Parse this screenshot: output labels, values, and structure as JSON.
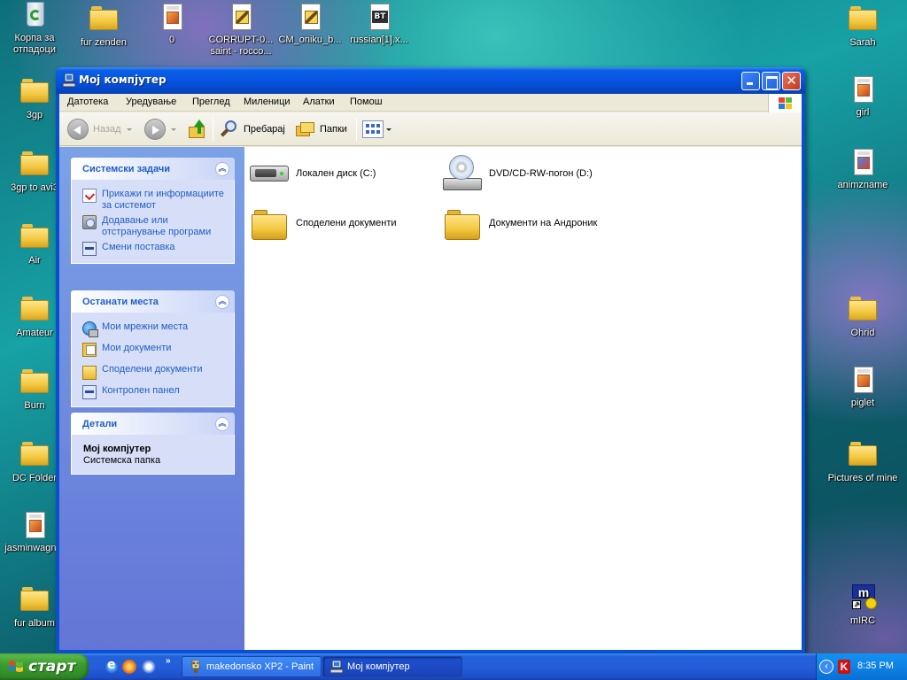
{
  "desktop": {
    "icons_left": [
      {
        "label": "Корпа за отпадоци",
        "icon": "recycle-bin-icon"
      },
      {
        "label": "3gp",
        "icon": "folder-icon"
      },
      {
        "label": "3gp to avi3",
        "icon": "folder-icon"
      },
      {
        "label": "Air",
        "icon": "folder-icon"
      },
      {
        "label": "Amateur",
        "icon": "folder-icon"
      },
      {
        "label": "Burn",
        "icon": "folder-icon"
      },
      {
        "label": "DC Folder",
        "icon": "folder-icon"
      },
      {
        "label": "jasminwagn...",
        "icon": "image-file-icon"
      },
      {
        "label": "fur album",
        "icon": "folder-icon"
      }
    ],
    "icons_top": [
      {
        "label": "fur zenden",
        "icon": "folder-icon"
      },
      {
        "label": "0",
        "icon": "image-file-icon"
      },
      {
        "label": "CORRUPT-0... saint - rocco...",
        "icon": "archive-file-icon"
      },
      {
        "label": "CM_oniku_b...",
        "icon": "archive-file-icon"
      },
      {
        "label": "russian[1].x...",
        "icon": "torrent-file-icon"
      }
    ],
    "icons_right": [
      {
        "label": "Sarah",
        "icon": "folder-icon"
      },
      {
        "label": "girl",
        "icon": "image-file-icon"
      },
      {
        "label": "animzname",
        "icon": "image-file-icon"
      },
      {
        "label": "Ohrid",
        "icon": "folder-icon"
      },
      {
        "label": "piglet",
        "icon": "image-file-icon"
      },
      {
        "label": "Pictures of mine",
        "icon": "folder-icon"
      },
      {
        "label": "mIRC",
        "icon": "mirc-shortcut-icon"
      }
    ]
  },
  "window": {
    "title": "Мој компјутер",
    "menu": [
      "Датотека",
      "Уредување",
      "Преглед",
      "Миленици",
      "Алатки",
      "Помош"
    ],
    "toolbar": {
      "back": "Назад",
      "search": "Пребарај",
      "folders": "Папки"
    },
    "left_pane": {
      "system_tasks": {
        "title": "Системски задачи",
        "items": [
          {
            "label": "Прикажи ги информациите за системот",
            "icon": "system-info-icon"
          },
          {
            "label": "Додавање или отстранување програми",
            "icon": "add-remove-programs-icon"
          },
          {
            "label": "Смени поставка",
            "icon": "control-panel-icon"
          }
        ]
      },
      "other_places": {
        "title": "Останати места",
        "items": [
          {
            "label": "Мои мрежни места",
            "icon": "network-places-icon"
          },
          {
            "label": "Мои документи",
            "icon": "my-documents-icon"
          },
          {
            "label": "Споделени документи",
            "icon": "folder-icon"
          },
          {
            "label": "Контролен панел",
            "icon": "control-panel-icon"
          }
        ]
      },
      "details": {
        "title": "Детали",
        "name": "Мој компјутер",
        "type": "Системска папка"
      }
    },
    "items": [
      {
        "label": "Локален диск (C:)",
        "icon": "hard-drive-icon"
      },
      {
        "label": "DVD/CD-RW-погон (D:)",
        "icon": "cd-drive-icon"
      },
      {
        "label": "Споделени документи",
        "icon": "folder-icon"
      },
      {
        "label": "Документи на Андроник",
        "icon": "folder-icon"
      }
    ]
  },
  "taskbar": {
    "start_label": "старт",
    "quick_launch_more": "»",
    "tasks": [
      {
        "label": "makedonsko XP2 - Paint",
        "active": false
      },
      {
        "label": "Мој компјутер",
        "active": true
      }
    ],
    "tray_antivirus": "K",
    "clock": "8:35 PM"
  }
}
